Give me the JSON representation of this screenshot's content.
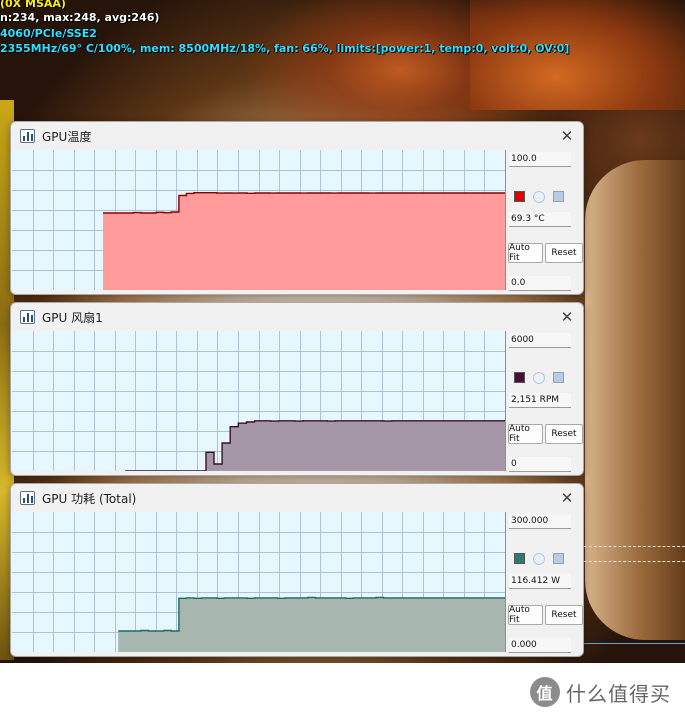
{
  "osd": {
    "line1": "(0X MSAA)",
    "line2": "n:234, max:248, avg:246)",
    "line3": "4060/PCIe/SSE2",
    "line4": "2355MHz/69° C/100%, mem: 8500MHz/18%, fan: 66%, limits:[power:1, temp:0, volt:0, OV:0]"
  },
  "windows": [
    {
      "title": "GPU温度",
      "max_label": "100.0",
      "current": "69.3 °C",
      "min_label": "0.0",
      "auto_fit_label": "Auto Fit",
      "reset_label": "Reset",
      "colors": {
        "line": "#8a0000",
        "fill": "#ff9b9b",
        "swatch": "#e00000"
      }
    },
    {
      "title": "GPU 风扇1",
      "max_label": "6000",
      "current": "2,151 RPM",
      "min_label": "0",
      "auto_fit_label": "Auto Fit",
      "reset_label": "Reset",
      "colors": {
        "line": "#3a0f2c",
        "fill": "#a596a8",
        "swatch": "#4a0d34"
      }
    },
    {
      "title": "GPU 功耗 (Total)",
      "max_label": "300.000",
      "current": "116.412 W",
      "min_label": "0.000",
      "auto_fit_label": "Auto Fit",
      "reset_label": "Reset",
      "colors": {
        "line": "#1f6a5c",
        "fill": "#a8b6b0",
        "swatch": "#2e7a72"
      }
    }
  ],
  "chart_data": [
    {
      "type": "area",
      "title": "GPU温度",
      "ylim": [
        0,
        100
      ],
      "grid": true,
      "series": [
        {
          "values": [
            null,
            null,
            null,
            null,
            null,
            null,
            null,
            null,
            null,
            null,
            null,
            null,
            55,
            55,
            55,
            55,
            55.3,
            55,
            55,
            55.5,
            55.2,
            55.7,
            67.5,
            69,
            69.5,
            69.5,
            69.5,
            69.2,
            69.3,
            69.2,
            69.3,
            69.1,
            69.3,
            69.3,
            69.2,
            69.3,
            69.3,
            69.3,
            69.2,
            69.3,
            69.3,
            69.3,
            69.2,
            69.3,
            69.3,
            69.3,
            69.3,
            69.2,
            69.3,
            69.3,
            69.3,
            69.3,
            69.3,
            69.3,
            69.3,
            69.3,
            69.3,
            69.3,
            69.3,
            69.3,
            69.3,
            69.3,
            69.3,
            69.3,
            69.3,
            69.3
          ]
        }
      ]
    },
    {
      "type": "area",
      "title": "GPU 风扇1",
      "ylim": [
        0,
        6000
      ],
      "grid": true,
      "series": [
        {
          "values": [
            null,
            null,
            null,
            null,
            null,
            null,
            null,
            null,
            null,
            null,
            null,
            null,
            null,
            null,
            0,
            0,
            0,
            0,
            0,
            0,
            0,
            0,
            0,
            0,
            800,
            300,
            1200,
            1900,
            2050,
            2100,
            2150,
            2150,
            2140,
            2150,
            2150,
            2140,
            2150,
            2150,
            2150,
            2140,
            2150,
            2150,
            2150,
            2150,
            2150,
            2150,
            2140,
            2150,
            2150,
            2150,
            2150,
            2150,
            2150,
            2150,
            2150,
            2151,
            2151,
            2151,
            2151,
            2151,
            2151,
            2151
          ]
        }
      ]
    },
    {
      "type": "area",
      "title": "GPU 功耗 (Total)",
      "ylim": [
        0,
        300
      ],
      "grid": true,
      "series": [
        {
          "values": [
            null,
            null,
            null,
            null,
            null,
            null,
            null,
            null,
            null,
            null,
            null,
            null,
            null,
            null,
            45,
            45,
            45,
            46,
            45,
            45,
            46,
            45,
            115,
            116,
            115,
            116,
            116,
            115,
            116,
            116,
            116,
            115,
            116,
            116,
            116,
            115,
            116,
            116,
            116,
            117,
            116,
            116,
            116,
            116,
            115,
            116,
            116,
            116,
            117,
            116,
            116,
            116,
            116,
            116,
            116,
            116,
            116,
            116,
            116,
            116,
            116,
            116,
            116,
            116,
            116,
            116
          ]
        }
      ]
    }
  ],
  "brand": {
    "text": "什么值得买",
    "logo_glyph": "值"
  }
}
